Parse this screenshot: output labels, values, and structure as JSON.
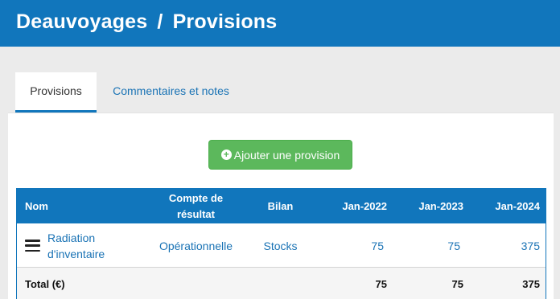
{
  "header": {
    "company": "Deauvoyages",
    "separator": "/",
    "section": "Provisions"
  },
  "tabs": [
    {
      "label": "Provisions",
      "active": true
    },
    {
      "label": "Commentaires et notes",
      "active": false
    }
  ],
  "add_button": {
    "label": "Ajouter une provision",
    "icon": "plus-circle-icon"
  },
  "table": {
    "headers": {
      "nom": "Nom",
      "compte_line1": "Compte de",
      "compte_line2": "résultat",
      "bilan": "Bilan",
      "jan2022": "Jan-2022",
      "jan2023": "Jan-2023",
      "jan2024": "Jan-2024"
    },
    "rows": [
      {
        "nom_line1": "Radiation",
        "nom_line2": "d'inventaire",
        "compte": "Opérationnelle",
        "bilan": "Stocks",
        "jan2022": "75",
        "jan2023": "75",
        "jan2024": "375"
      }
    ],
    "total": {
      "label": "Total (€)",
      "jan2022": "75",
      "jan2023": "75",
      "jan2024": "375"
    }
  },
  "colors": {
    "primary": "#1176bc",
    "success": "#5cb85c",
    "link": "#1a73b5",
    "background": "#ebebeb"
  }
}
